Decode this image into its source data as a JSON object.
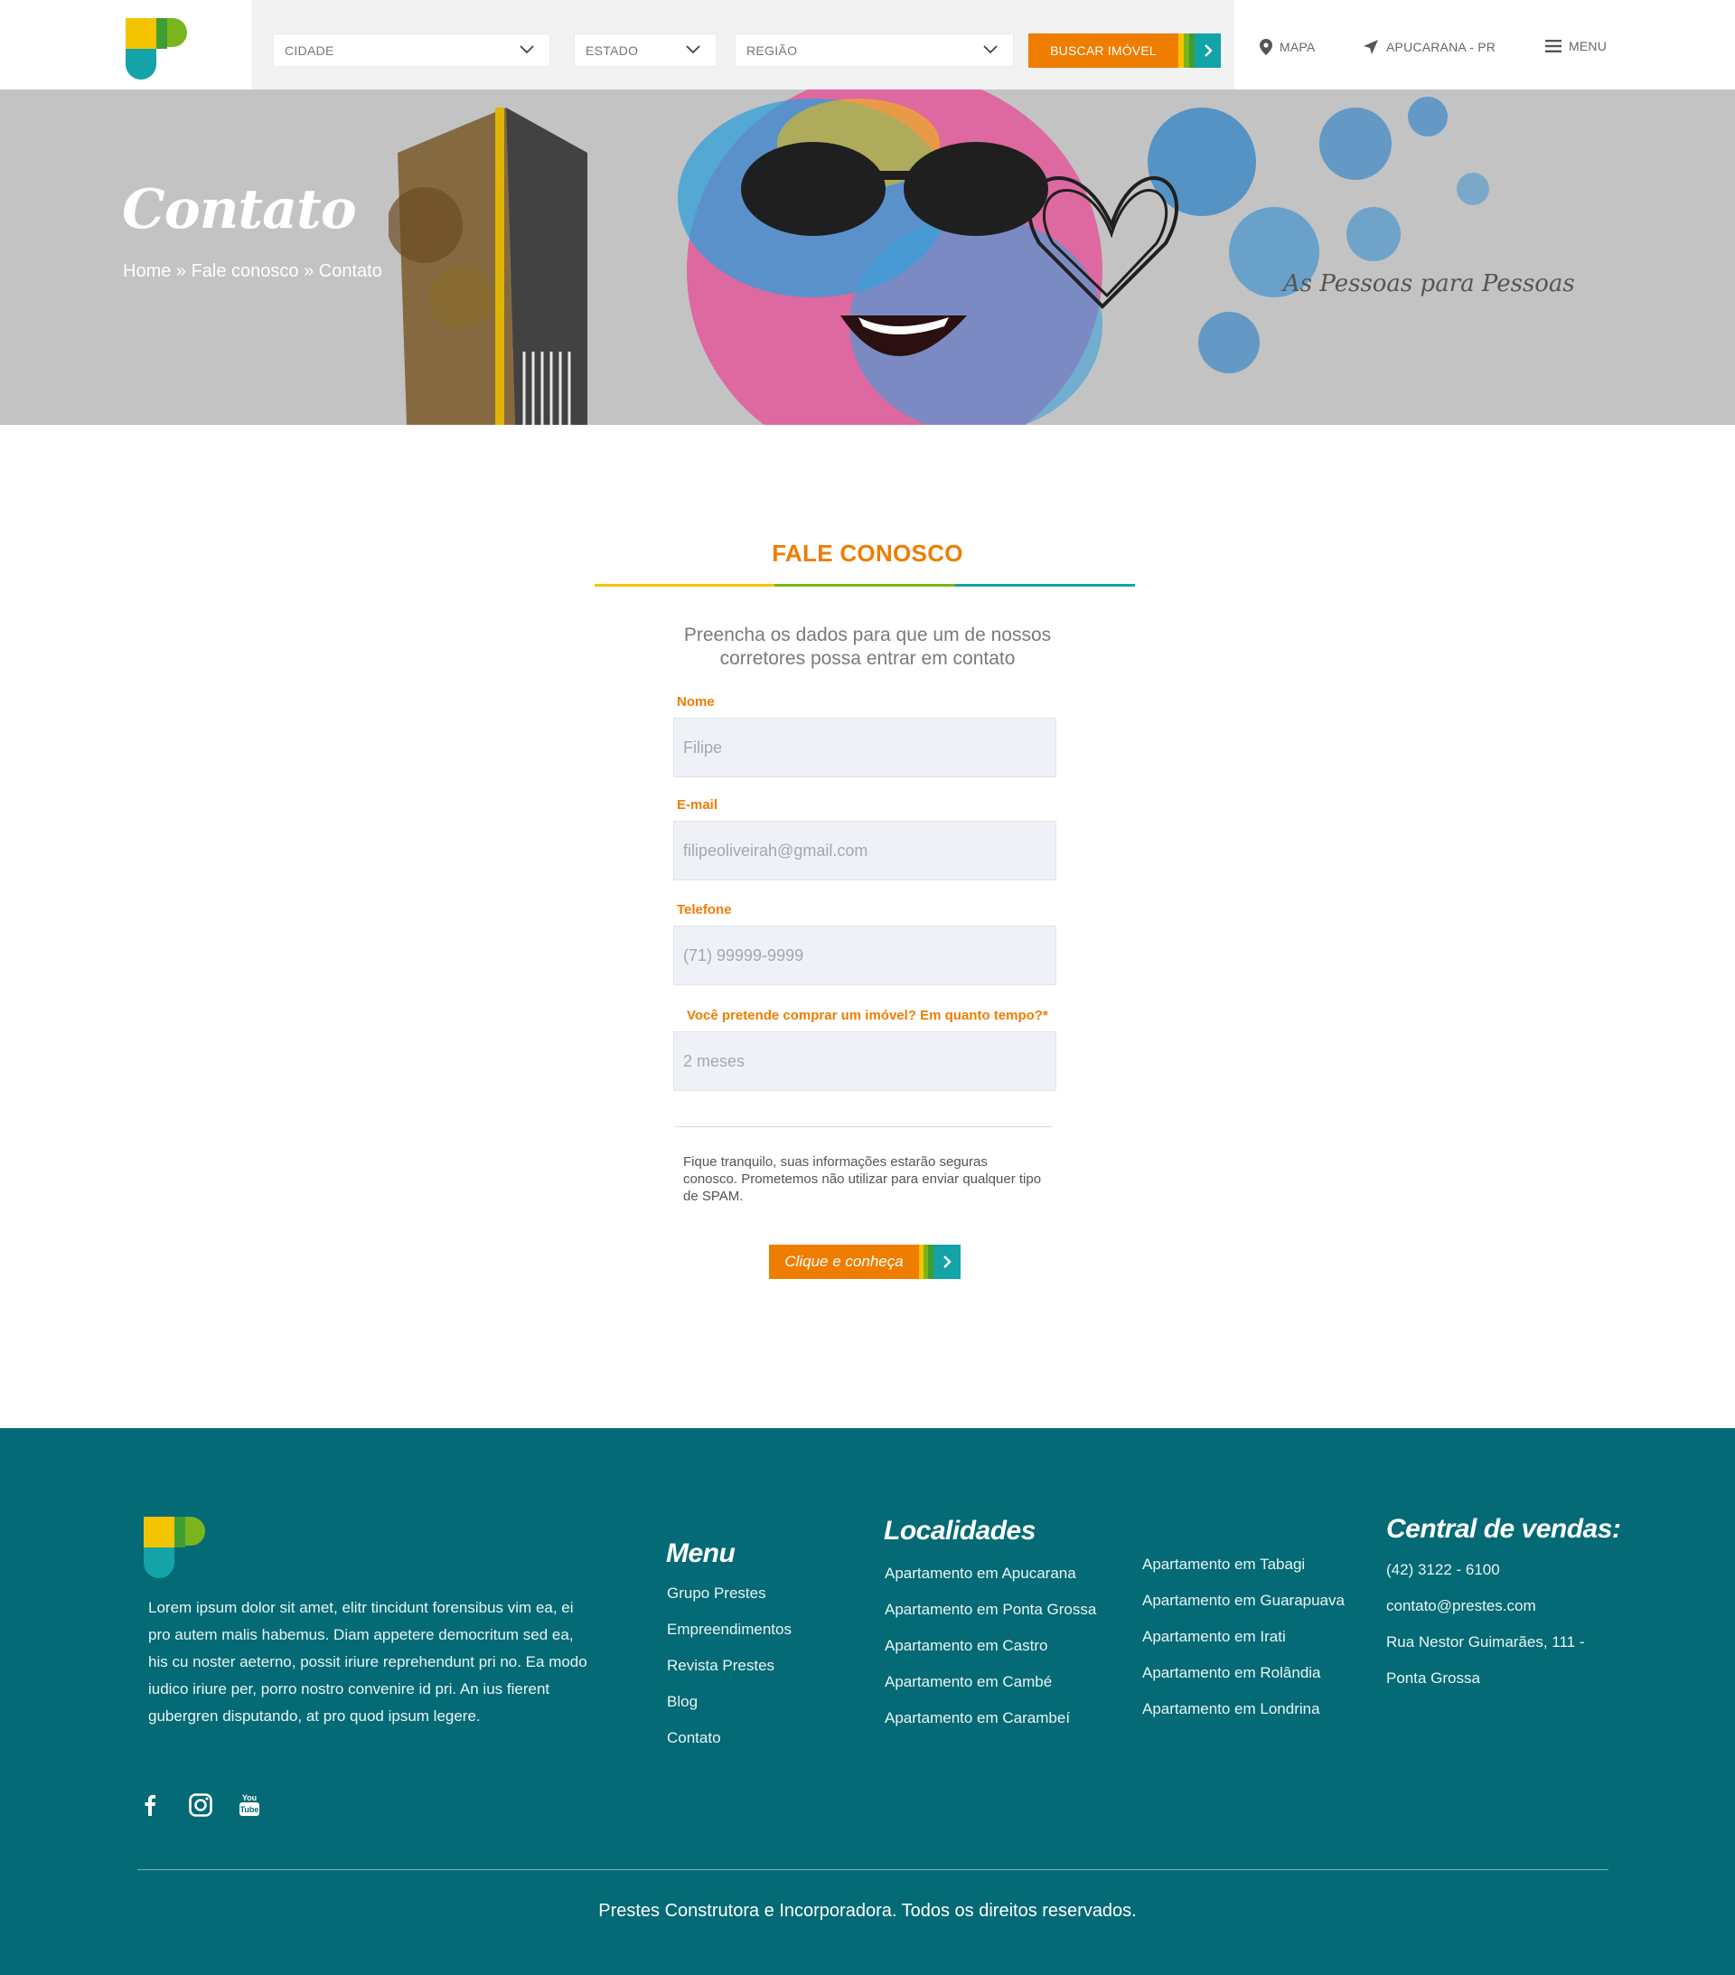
{
  "header": {
    "search": {
      "cidade": "CIDADE",
      "estado": "ESTADO",
      "regiao": "REGIÃO",
      "buscar": "BUSCAR IMÓVEL"
    },
    "nav": {
      "mapa": "MAPA",
      "location": "APUCARANA - PR",
      "menu": "MENU"
    }
  },
  "hero": {
    "title": "Contato",
    "breadcrumb": "Home » Fale conosco » Contato",
    "tagline": "As Pessoas para Pessoas"
  },
  "form": {
    "title": "FALE CONOSCO",
    "intro": "Preencha os dados para que um de nossos corretores possa entrar em contato",
    "fields": [
      {
        "label": "Nome",
        "value": "Filipe"
      },
      {
        "label": "E-mail",
        "value": "filipeoliveirah@gmail.com"
      },
      {
        "label": "Telefone",
        "value": "(71) 99999-9999"
      },
      {
        "label": "Você pretende comprar um imóvel? Em quanto tempo?*",
        "value": "2 meses"
      }
    ],
    "privacy": "Fique tranquilo, suas informações estarão seguras conosco. Prometemos não utilizar para enviar qualquer tipo de SPAM.",
    "submit": "Clique e conheça"
  },
  "footer": {
    "about": "Lorem ipsum dolor sit amet, elitr tincidunt forensibus vim ea, ei pro autem malis habemus. Diam appetere democritum sed ea, his cu noster aeterno, possit iriure reprehendunt pri no. Ea modo iudico iriure per, porro nostro convenire id pri. An ius fierent gubergren disputando, at pro quod ipsum legere.",
    "menu_title": "Menu",
    "menu": [
      "Grupo Prestes",
      "Empreendimentos",
      "Revista Prestes",
      "Blog",
      "Contato"
    ],
    "localidades_title": "Localidades",
    "localidades_col1": [
      "Apartamento em Apucarana",
      "Apartamento em Ponta Grossa",
      "Apartamento em Castro",
      "Apartamento em Cambé",
      "Apartamento em Carambeí"
    ],
    "localidades_col2": [
      "Apartamento em Tabagi",
      "Apartamento em Guarapuava",
      "Apartamento em Irati",
      "Apartamento em Rolândia",
      "Apartamento em Londrina"
    ],
    "vendas_title": "Central de vendas:",
    "phone": "(42)  3122 - 6100",
    "email": "contato@prestes.com",
    "address_1": "Rua Nestor Guimarães, 111 -",
    "address_2": "Ponta Grossa",
    "social": [
      "facebook-icon",
      "instagram-icon",
      "youtube-icon"
    ],
    "copyright": "Prestes Construtora e Incorporadora. Todos os direitos reservados."
  },
  "colors": {
    "orange": "#ee7d00",
    "teal": "#13a3a9",
    "footer": "#046a75",
    "yellow": "#f5c400",
    "green": "#7ab51d"
  }
}
